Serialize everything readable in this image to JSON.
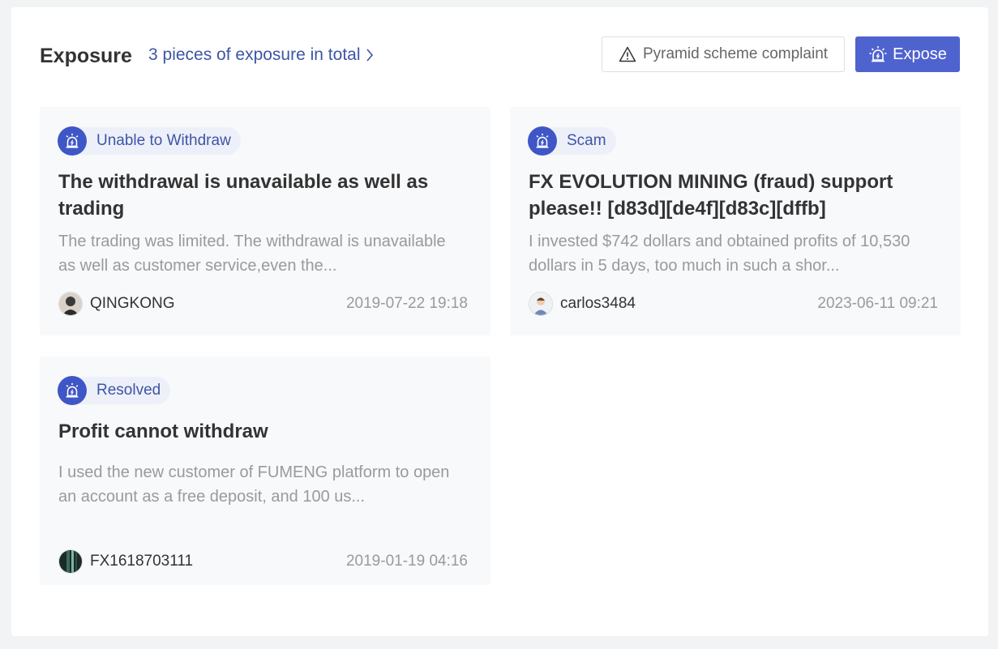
{
  "header": {
    "title": "Exposure",
    "total_link": "3 pieces of exposure in total",
    "complaint_button": "Pyramid scheme complaint",
    "expose_button": "Expose"
  },
  "cards": [
    {
      "tag": "Unable to Withdraw",
      "title": "The withdrawal is unavailable as well as trading",
      "description": "The trading was limited. The withdrawal is unavailable as well as customer service,even the...",
      "author": "QINGKONG",
      "date": "2019-07-22 19:18"
    },
    {
      "tag": "Scam",
      "title": "FX EVOLUTION MINING (fraud) support please!! [d83d][de4f][d83c][dffb]",
      "description": "I invested $742 dollars and obtained profits of 10,530 dollars in 5 days, too much in such a shor...",
      "author": "carlos3484",
      "date": "2023-06-11 09:21"
    },
    {
      "tag": "Resolved",
      "title": "Profit cannot withdraw",
      "description": "I used the new customer of FUMENG platform to open an account as a free deposit, and 100 us...",
      "author": "FX1618703111",
      "date": "2019-01-19 04:16"
    }
  ],
  "colors": {
    "accent": "#4f63cf",
    "link": "#3d55a5",
    "tag_bg": "#edf0f9",
    "card_bg": "#f8f9fb"
  },
  "icons": {
    "complaint": "warning-triangle-icon",
    "expose": "alarm-light-icon",
    "tag": "alarm-light-icon",
    "link": "chevron-right-icon"
  }
}
